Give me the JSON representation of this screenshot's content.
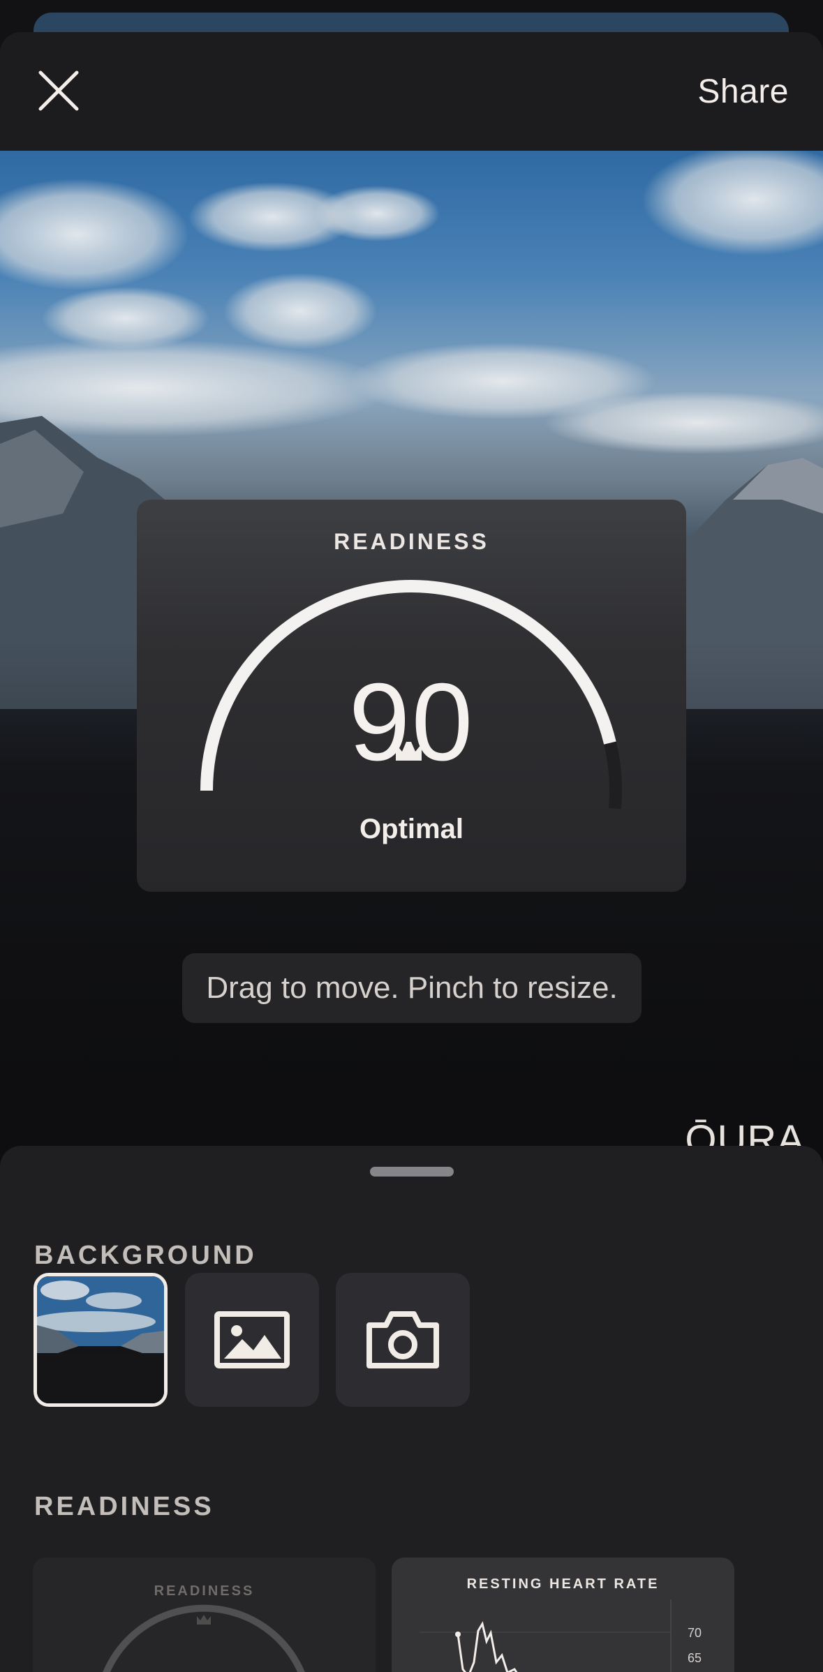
{
  "header": {
    "close_icon": "close-icon",
    "share_label": "Share"
  },
  "widget": {
    "title": "READINESS",
    "score": "90",
    "score_fraction": 0.9,
    "status": "Optimal",
    "badge_icon": "crown-icon"
  },
  "hint": "Drag to move. Pinch to resize.",
  "brand": "ŌURA",
  "panel": {
    "background_label": "BACKGROUND",
    "background_options": [
      {
        "name": "mountain-photo",
        "selected": true
      },
      {
        "name": "image-gallery-icon",
        "selected": false
      },
      {
        "name": "camera-icon",
        "selected": false
      }
    ],
    "readiness_label": "READINESS",
    "cards": [
      {
        "title": "READINESS"
      },
      {
        "title": "RESTING HEART RATE",
        "axis_labels": [
          "70",
          "65"
        ]
      }
    ]
  },
  "colors": {
    "background": "#121215",
    "sheet": "#1b1b1e",
    "panel": "#1f1f22",
    "text": "#f3eeea",
    "arc": "#f3f2f1"
  }
}
